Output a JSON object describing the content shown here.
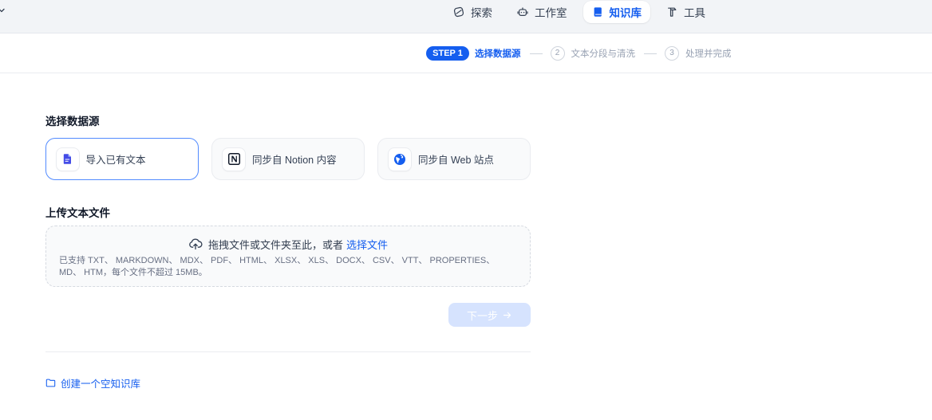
{
  "top_nav": {
    "collapse_icon": "chevron-down-icon",
    "items": [
      {
        "label": "探索",
        "icon": "explore-icon",
        "active": false
      },
      {
        "label": "工作室",
        "icon": "robot-icon",
        "active": false
      },
      {
        "label": "知识库",
        "icon": "book-icon",
        "active": true
      },
      {
        "label": "工具",
        "icon": "tool-icon",
        "active": false
      }
    ]
  },
  "steps": [
    {
      "badge": "STEP 1",
      "label": "选择数据源",
      "active": true
    },
    {
      "badge": "2",
      "label": "文本分段与清洗",
      "active": false
    },
    {
      "badge": "3",
      "label": "处理并完成",
      "active": false
    }
  ],
  "data_source": {
    "heading": "选择数据源",
    "options": [
      {
        "label": "导入已有文本",
        "icon": "file-text-icon",
        "selected": true
      },
      {
        "label": "同步自 Notion 内容",
        "icon": "notion-icon",
        "selected": false
      },
      {
        "label": "同步自 Web 站点",
        "icon": "globe-icon",
        "selected": false
      }
    ]
  },
  "upload": {
    "heading": "上传文本文件",
    "icon": "upload-cloud-icon",
    "prompt": "拖拽文件或文件夹至此，或者",
    "browse_link": "选择文件",
    "supported_formats": "已支持 TXT、 MARKDOWN、 MDX、 PDF、 HTML、 XLSX、 XLS、 DOCX、 CSV、 VTT、 PROPERTIES、 MD、 HTM，每个文件不超过 15MB。"
  },
  "next_button": {
    "label": "下一步",
    "icon": "arrow-right-icon",
    "disabled": true
  },
  "create_empty": {
    "label": "创建一个空知识库",
    "icon": "folder-icon"
  },
  "colors": {
    "accent": "#155eef",
    "nav_background": "#f2f4f7",
    "selected_border": "#528bff",
    "disabled_button": "#d6e3fe",
    "text_primary": "#101828",
    "text_secondary": "#354052",
    "text_muted": "#98a2b3"
  }
}
